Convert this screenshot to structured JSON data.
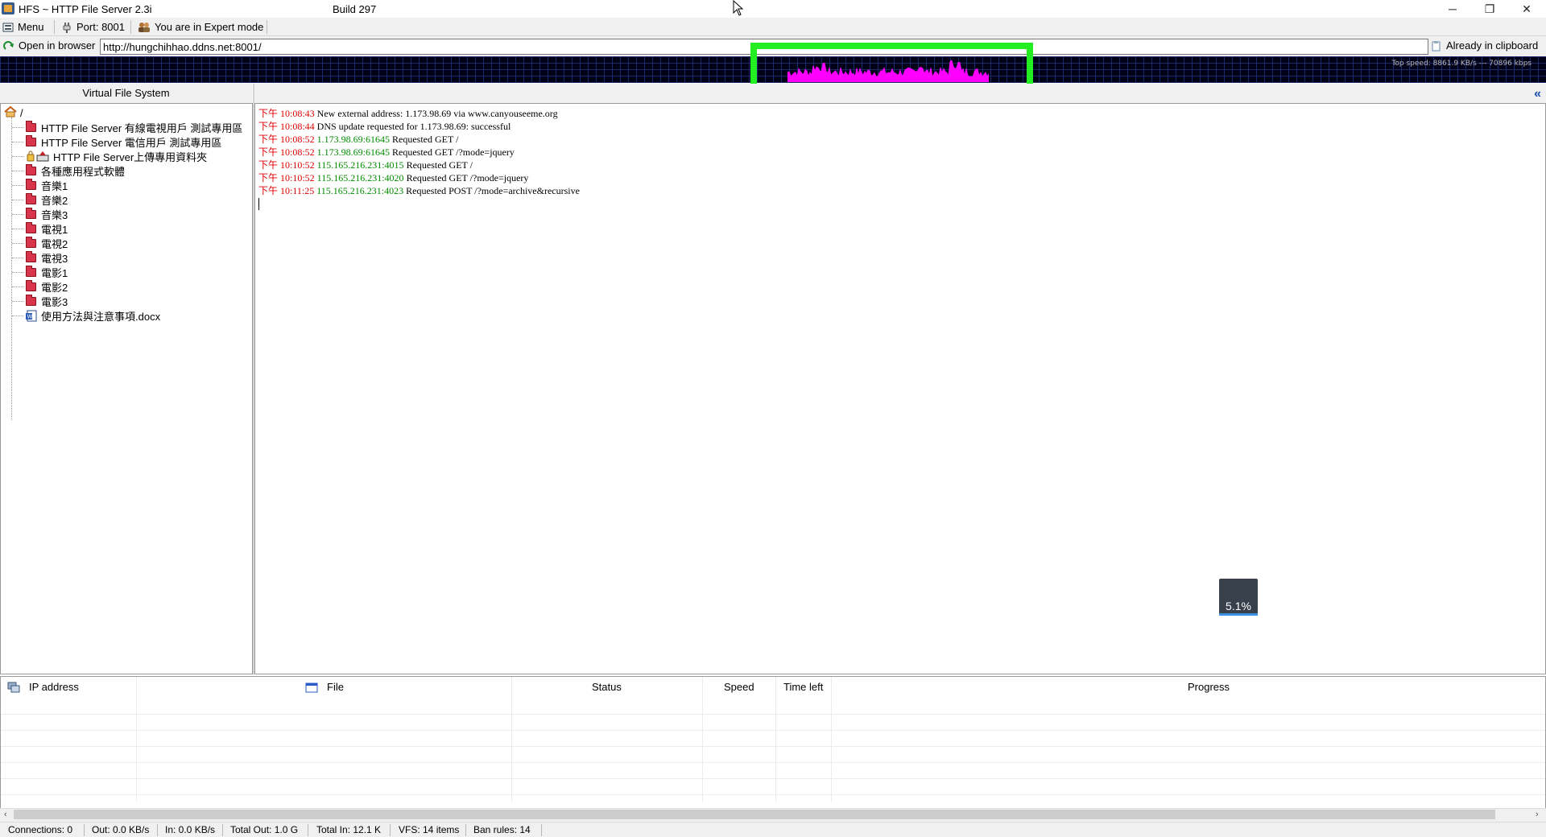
{
  "window": {
    "title": "HFS ~ HTTP File Server 2.3i",
    "build": "Build 297",
    "minimize": "─",
    "restore": "❐",
    "close": "✕"
  },
  "menubar": {
    "menu": "Menu",
    "port": "Port: 8001",
    "mode": "You are in Expert mode"
  },
  "addressbar": {
    "open_browser": "Open in browser",
    "url": "http://hungchihhao.ddns.net:8001/",
    "clipboard": "Already in clipboard"
  },
  "graph": {
    "top_speed": "Top speed: 8861.9 KB/s   ---   70896 kbps",
    "highlight_color": "#22ee22",
    "line_color": "#ff00ff"
  },
  "vfs": {
    "header": "Virtual File System",
    "root": "/",
    "items": [
      {
        "label": "HTTP File Server 有線電視用戶 測試專用區",
        "icon": "folder-icon"
      },
      {
        "label": "HTTP File Server 電信用戶 測試專用區",
        "icon": "folder-icon"
      },
      {
        "label": "HTTP File Server上傳專用資料夾",
        "icon": "upload-folder-icon"
      },
      {
        "label": "各種應用程式軟體",
        "icon": "folder-icon"
      },
      {
        "label": "音樂1",
        "icon": "folder-icon"
      },
      {
        "label": "音樂2",
        "icon": "folder-icon"
      },
      {
        "label": "音樂3",
        "icon": "folder-icon"
      },
      {
        "label": "電視1",
        "icon": "folder-icon"
      },
      {
        "label": "電視2",
        "icon": "folder-icon"
      },
      {
        "label": "電視3",
        "icon": "folder-icon"
      },
      {
        "label": "電影1",
        "icon": "folder-icon"
      },
      {
        "label": "電影2",
        "icon": "folder-icon"
      },
      {
        "label": "電影3",
        "icon": "folder-icon"
      },
      {
        "label": "使用方法與注意事項.docx",
        "icon": "word-document-icon"
      }
    ]
  },
  "log": [
    {
      "time": "下午 10:08:43",
      "ip": "",
      "msg": "New external address: 1.173.98.69 via www.canyouseeme.org"
    },
    {
      "time": "下午 10:08:44",
      "ip": "",
      "msg": "DNS update requested for 1.173.98.69: successful"
    },
    {
      "time": "下午 10:08:52",
      "ip": "1.173.98.69:61645",
      "msg": "Requested GET /"
    },
    {
      "time": "下午 10:08:52",
      "ip": "1.173.98.69:61645",
      "msg": "Requested GET /?mode=jquery"
    },
    {
      "time": "下午 10:10:52",
      "ip": "115.165.216.231:4015",
      "msg": "Requested GET /"
    },
    {
      "time": "下午 10:10:52",
      "ip": "115.165.216.231:4020",
      "msg": "Requested GET /?mode=jquery"
    },
    {
      "time": "下午 10:11:25",
      "ip": "115.165.216.231:4023",
      "msg": "Requested POST /?mode=archive&recursive"
    }
  ],
  "overlay_percent": "5.1%",
  "connections": {
    "columns": [
      "IP address",
      "File",
      "Status",
      "Speed",
      "Time left",
      "Progress"
    ],
    "rows": []
  },
  "statusbar": {
    "connections": "Connections: 0",
    "out": "Out: 0.0 KB/s",
    "in": "In: 0.0 KB/s",
    "total_out": "Total Out: 1.0 G",
    "total_in": "Total In: 12.1 K",
    "vfs": "VFS: 14 items",
    "ban": "Ban rules: 14"
  }
}
